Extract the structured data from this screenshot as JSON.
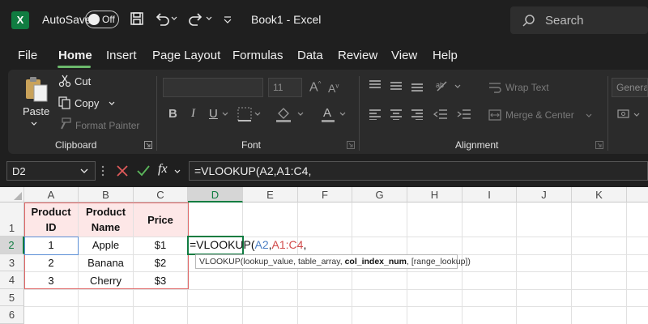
{
  "titlebar": {
    "autosave_label": "AutoSave",
    "autosave_state": "Off",
    "doc_title": "Book1  -  Excel",
    "search_placeholder": "Search"
  },
  "menu": [
    "File",
    "Home",
    "Insert",
    "Page Layout",
    "Formulas",
    "Data",
    "Review",
    "View",
    "Help"
  ],
  "ribbon": {
    "clipboard": {
      "paste": "Paste",
      "cut": "Cut",
      "copy": "Copy",
      "format_painter": "Format Painter",
      "label": "Clipboard"
    },
    "font": {
      "size": "11",
      "label": "Font"
    },
    "alignment": {
      "wrap_text": "Wrap Text",
      "merge_center": "Merge & Center",
      "label": "Alignment"
    },
    "number": {
      "format": "General"
    }
  },
  "formula_bar": {
    "name_box": "D2",
    "fx": "fx",
    "formula": "=VLOOKUP(A2,A1:C4,"
  },
  "sheet": {
    "columns": [
      "A",
      "B",
      "C",
      "D",
      "E",
      "F",
      "G",
      "H",
      "I",
      "J",
      "K"
    ],
    "rows": [
      "1",
      "2",
      "3",
      "4",
      "5",
      "6"
    ],
    "header_row": {
      "a_line1": "Product",
      "a_line2": "ID",
      "b_line1": "Product",
      "b_line2": "Name",
      "c": "Price"
    },
    "data": [
      {
        "id": "1",
        "name": "Apple",
        "price": "$1"
      },
      {
        "id": "2",
        "name": "Banana",
        "price": "$2"
      },
      {
        "id": "3",
        "name": "Cherry",
        "price": "$3"
      }
    ],
    "active_cell": {
      "prefix": "=VLOOKUP(",
      "ref1": "A2",
      "comma1": ",",
      "ref2": "A1:C4",
      "comma2": ","
    },
    "tooltip": {
      "fn": "VLOOKUP(",
      "arg1": "lookup_value, table_array, ",
      "current": "col_index_num",
      "rest": ", [range_lookup])"
    }
  },
  "colors": {
    "accent": "#107c41",
    "ref1": "#4a7ec4",
    "ref2": "#d14b4b",
    "header_fill": "#fde7e7"
  }
}
